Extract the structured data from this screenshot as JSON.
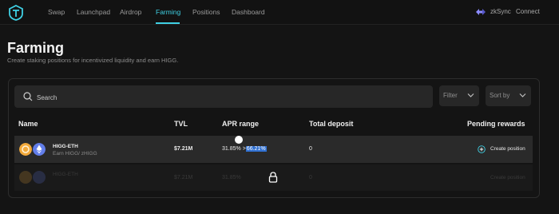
{
  "nav": {
    "items": [
      {
        "label": "Swap",
        "active": false
      },
      {
        "label": "Launchpad",
        "active": false
      },
      {
        "label": "Airdrop",
        "active": false
      },
      {
        "label": "Farming",
        "active": true
      },
      {
        "label": "Positions",
        "active": false
      },
      {
        "label": "Dashboard",
        "active": false
      }
    ],
    "network": "zkSync",
    "connect": "Connect"
  },
  "page": {
    "title": "Farming",
    "subtitle": "Create staking positions for incentivized liquidity and earn HIGG."
  },
  "search": {
    "placeholder": "Search"
  },
  "filters": {
    "filter_label": "Filter",
    "sort_label": "Sort by"
  },
  "table": {
    "headers": [
      "Name",
      "TVL",
      "APR range",
      "Total deposit",
      "Pending rewards"
    ],
    "rows": [
      {
        "pair": "HIGG-ETH",
        "earn": "Earn HIGG/ zHIGG",
        "tvl": "$7.21M",
        "apr_min": "31.85%",
        "apr_sep": ">",
        "apr_max": "66.21%",
        "total_deposit": "0",
        "action": "Create position"
      }
    ],
    "locked_row": {
      "pair": "HIGG-ETH",
      "tvl": "$7.21M",
      "apr": "31.85%",
      "total_deposit": "0",
      "action": "Create position"
    }
  },
  "colors": {
    "accent": "#3fd0e4",
    "background": "#141414",
    "row": "#2a2a2a",
    "highlight": "#2f6fd0",
    "higg_token": "#f2a93b",
    "eth_token": "#627eea"
  },
  "icons": [
    "logo-icon",
    "zksync-icon",
    "search-icon",
    "chevron-down-icon",
    "higg-token-icon",
    "eth-token-icon",
    "plus-circle-icon",
    "lock-icon"
  ]
}
